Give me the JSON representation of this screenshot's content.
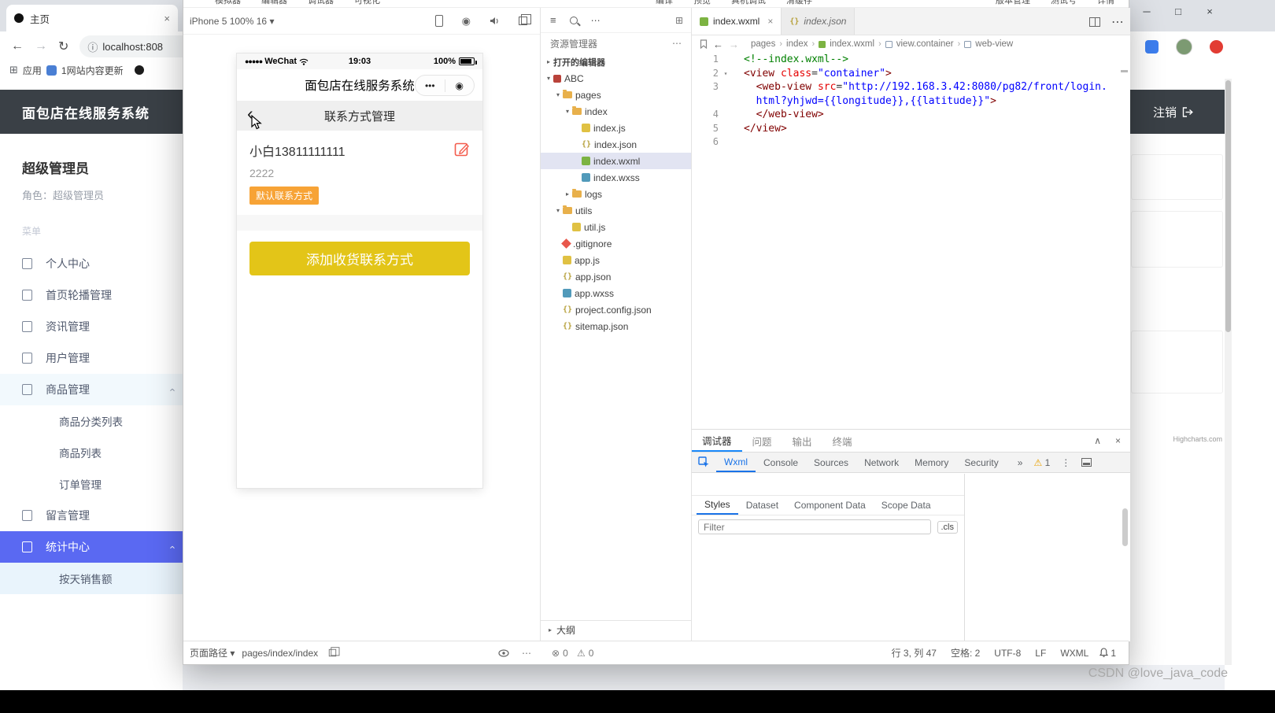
{
  "watermark": "CSDN @love_java_code",
  "glyphs": {
    "more_h": "⋯",
    "hamburger": "≡",
    "back": "←",
    "forward": "→",
    "reload": "↻",
    "info": "ⓘ",
    "apps": "⊞",
    "chev_down": "▾",
    "chev_right": "▸",
    "chev_left": "‹",
    "chev_sep": "›",
    "target": "◉",
    "dots3": "•••",
    "min": "─",
    "max": "□",
    "close": "×",
    "collapse": "∧",
    "err": "⊗",
    "warn": "⚠",
    "more2": "»",
    "kebab": "⋮",
    "newfile": "⊞"
  },
  "colors": {
    "accent": "#5a69f2",
    "header_dark": "#3a4046",
    "wechat_yellow": "#e3c518",
    "badge_orange": "#f7a336",
    "edit_red": "#f35c4d",
    "devtools_blue": "#1a73e8",
    "tab_blue": "#1989fa"
  },
  "browser": {
    "tab_title": "主页",
    "url": "localhost:808",
    "bookmarks_apps": "应用",
    "bookmark_site": "1网站内容更新",
    "logout_label": "注销",
    "highcharts": "Highcharts.com",
    "admin": {
      "header_title": "面包店在线服务系统",
      "name": "超级管理员",
      "role": "角色：超级管理员",
      "menu_label": "菜单",
      "menu": [
        {
          "label": "个人中心",
          "type": "item"
        },
        {
          "label": "首页轮播管理",
          "type": "item"
        },
        {
          "label": "资讯管理",
          "type": "item"
        },
        {
          "label": "用户管理",
          "type": "item"
        },
        {
          "label": "商品管理",
          "type": "item",
          "expanded": true,
          "hover": true
        },
        {
          "label": "商品分类列表",
          "type": "sub"
        },
        {
          "label": "商品列表",
          "type": "sub"
        },
        {
          "label": "订单管理",
          "type": "sub"
        },
        {
          "label": "留言管理",
          "type": "item"
        },
        {
          "label": "统计中心",
          "type": "item",
          "active": true,
          "expanded": true
        },
        {
          "label": "按天销售额",
          "type": "sub",
          "subactive": true
        }
      ]
    }
  },
  "devtools": {
    "menubar_left": [
      "模拟器",
      "编辑器",
      "调试器",
      "可视化"
    ],
    "menubar_mid": [
      "编译",
      "预览",
      "真机调试",
      "清缓存"
    ],
    "menubar_right": [
      "版本管理",
      "测试号",
      "详情"
    ],
    "simulator": {
      "device_label": "iPhone 5 100% 16",
      "status": {
        "carrier_dots": "●●●●●",
        "carrier": "WeChat",
        "time": "19:03",
        "battery": "100%"
      },
      "nav_title": "面包店在线服务系统",
      "page_title": "联系方式管理",
      "contact_name": "小白13811111111",
      "contact_addr": "2222",
      "contact_badge": "默认联系方式",
      "add_btn": "添加收货联系方式"
    },
    "explorer": {
      "title": "资源管理器",
      "sections": {
        "open_editors": "打开的编辑器",
        "outline": "大纲"
      },
      "project": "ABC",
      "tree": [
        {
          "name": "pages",
          "depth": 1,
          "kind": "folder",
          "arrow": "open"
        },
        {
          "name": "index",
          "depth": 2,
          "kind": "folder",
          "arrow": "open"
        },
        {
          "name": "index.js",
          "depth": 3,
          "kind": "js"
        },
        {
          "name": "index.json",
          "depth": 3,
          "kind": "json"
        },
        {
          "name": "index.wxml",
          "depth": 3,
          "kind": "wxml",
          "selected": true
        },
        {
          "name": "index.wxss",
          "depth": 3,
          "kind": "wxss"
        },
        {
          "name": "logs",
          "depth": 2,
          "kind": "folder",
          "arrow": "closed"
        },
        {
          "name": "utils",
          "depth": 1,
          "kind": "folder",
          "arrow": "open"
        },
        {
          "name": "util.js",
          "depth": 2,
          "kind": "js"
        },
        {
          "name": ".gitignore",
          "depth": 1,
          "kind": "git"
        },
        {
          "name": "app.js",
          "depth": 1,
          "kind": "js"
        },
        {
          "name": "app.json",
          "depth": 1,
          "kind": "json"
        },
        {
          "name": "app.wxss",
          "depth": 1,
          "kind": "wxss"
        },
        {
          "name": "project.config.json",
          "depth": 1,
          "kind": "json"
        },
        {
          "name": "sitemap.json",
          "depth": 1,
          "kind": "json"
        }
      ]
    },
    "editor": {
      "tab1": "index.wxml",
      "tab2": "index.json",
      "breadcrumb": [
        {
          "label": "pages"
        },
        {
          "label": "index"
        },
        {
          "label": "index.wxml",
          "icon": "wxml"
        },
        {
          "label": "view.container",
          "icon": "sym"
        },
        {
          "label": "web-view",
          "icon": "sym"
        }
      ],
      "code": [
        {
          "n": "1",
          "tokens": [
            {
              "t": "<!--index.wxml-->",
              "c": "cm"
            }
          ]
        },
        {
          "n": "2",
          "fold": true,
          "tokens": [
            {
              "t": "<view",
              "c": "tag"
            },
            {
              "t": " ",
              "c": "pl"
            },
            {
              "t": "class",
              "c": "attr"
            },
            {
              "t": "=",
              "c": "pl"
            },
            {
              "t": "\"container\"",
              "c": "str"
            },
            {
              "t": ">",
              "c": "tag"
            }
          ]
        },
        {
          "n": "3",
          "tokens": [
            {
              "t": "  ",
              "c": "pl"
            },
            {
              "t": "<web-view",
              "c": "tag"
            },
            {
              "t": " ",
              "c": "pl"
            },
            {
              "t": "src",
              "c": "attr"
            },
            {
              "t": "=",
              "c": "pl"
            },
            {
              "t": "\"http://192.168.3.42:8080/pg82/front/login.",
              "c": "str"
            }
          ]
        },
        {
          "n": "",
          "tokens": [
            {
              "t": "  ",
              "c": "pl"
            },
            {
              "t": "html?yhjwd={{longitude}},{{latitude}}\"",
              "c": "str"
            },
            {
              "t": ">",
              "c": "tag"
            }
          ]
        },
        {
          "n": "4",
          "tokens": [
            {
              "t": "  ",
              "c": "pl"
            },
            {
              "t": "</web-view>",
              "c": "tag"
            }
          ]
        },
        {
          "n": "5",
          "tokens": [
            {
              "t": "</view>",
              "c": "tag"
            }
          ]
        },
        {
          "n": "6",
          "tokens": []
        }
      ]
    },
    "debugger": {
      "panel_tabs": [
        {
          "label": "调试器",
          "active": true
        },
        {
          "label": "问题"
        },
        {
          "label": "输出"
        },
        {
          "label": "终端"
        }
      ],
      "chrome_tabs": [
        {
          "label": "Wxml",
          "active": true
        },
        {
          "label": "Console"
        },
        {
          "label": "Sources"
        },
        {
          "label": "Network"
        },
        {
          "label": "Memory"
        },
        {
          "label": "Security"
        }
      ],
      "warn_count": "1",
      "style_tabs": [
        {
          "label": "Styles",
          "active": true
        },
        {
          "label": "Dataset"
        },
        {
          "label": "Component Data"
        },
        {
          "label": "Scope Data"
        }
      ],
      "filter_placeholder": "Filter",
      "cls": ".cls"
    },
    "statusbar": {
      "path_label": "页面路径",
      "path": "pages/index/index",
      "err": "0",
      "warn": "0",
      "line_col": "行 3, 列 47",
      "spaces": "空格: 2",
      "enc": "UTF-8",
      "eol": "LF",
      "lang": "WXML",
      "bell": "1"
    }
  }
}
